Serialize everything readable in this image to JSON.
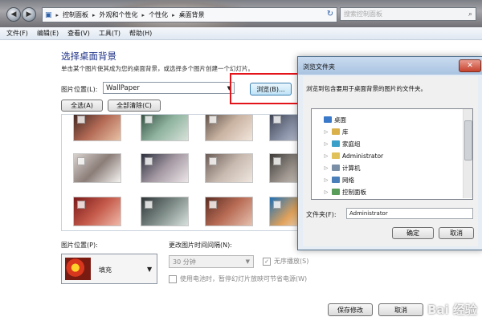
{
  "address_bar": {
    "breadcrumbs": [
      "控制面板",
      "外观和个性化",
      "个性化",
      "桌面背景"
    ],
    "search_placeholder": "搜索控制面板"
  },
  "menu": [
    "文件(F)",
    "编辑(E)",
    "查看(V)",
    "工具(T)",
    "帮助(H)"
  ],
  "main": {
    "heading": "选择桌面背景",
    "description": "单击某个图片使其成为您的桌面背景，或选择多个图片创建一个幻灯片。",
    "location_label": "图片位置(L):",
    "location_value": "WallPaper",
    "browse_label": "浏览(B)...",
    "select_all_label": "全选(A)",
    "clear_all_label": "全部清除(C)"
  },
  "thumbnails": [
    {
      "colors": [
        "#3b2420",
        "#b36a55",
        "#e8c1a5"
      ]
    },
    {
      "colors": [
        "#2f4b3c",
        "#8fb39f",
        "#d8e2d9"
      ]
    },
    {
      "colors": [
        "#5a4d46",
        "#c9b3a2",
        "#f2e6dc"
      ]
    },
    {
      "colors": [
        "#3a3e4f",
        "#8a93a8",
        "#dcdde4"
      ]
    },
    {
      "colors": [
        "#d8d2ce",
        "#8b7d78",
        "#f5f3f1"
      ]
    },
    {
      "colors": [
        "#2b2f3d",
        "#a59aa4",
        "#ede6e8"
      ]
    },
    {
      "colors": [
        "#6a5b56",
        "#c7b8ae",
        "#efe7e0"
      ]
    },
    {
      "colors": [
        "#3d3a38",
        "#9e968f",
        "#e2ddd8"
      ]
    },
    {
      "colors": [
        "#7a1a1a",
        "#c45a4a",
        "#f0b8a8"
      ]
    },
    {
      "colors": [
        "#2e3437",
        "#7c8a86",
        "#d7e0dd"
      ]
    },
    {
      "colors": [
        "#5b2c22",
        "#b86c55",
        "#e6c0ae"
      ]
    },
    {
      "colors": [
        "#1f6fb3",
        "#e0a15a",
        "#f5f5f5"
      ]
    }
  ],
  "bottom": {
    "position_label": "图片位置(P):",
    "position_value": "填充",
    "interval_label": "更改图片时间间隔(N):",
    "interval_value": "30 分钟",
    "shuffle_label": "无序播放(S)",
    "battery_label": "使用电池时，暂停幻灯片放映可节省电源(W)",
    "save_label": "保存修改",
    "cancel_label": "取消"
  },
  "dialog": {
    "title": "浏览文件夹",
    "instruction": "浏览到包含要用于桌面背景的图片的文件夹。",
    "tree": [
      {
        "label": "桌面",
        "level": 0,
        "arrow": "",
        "icon_color": "#3a78c9"
      },
      {
        "label": "库",
        "level": 1,
        "arrow": "▷",
        "icon_color": "#d9b04a"
      },
      {
        "label": "家庭组",
        "level": 1,
        "arrow": "▷",
        "icon_color": "#3aa0c9"
      },
      {
        "label": "Administrator",
        "level": 1,
        "arrow": "▷",
        "icon_color": "#e1c25a"
      },
      {
        "label": "计算机",
        "level": 1,
        "arrow": "▷",
        "icon_color": "#7a8fa6"
      },
      {
        "label": "网络",
        "level": 1,
        "arrow": "▷",
        "icon_color": "#4a7fb9"
      },
      {
        "label": "控制面板",
        "level": 1,
        "arrow": "▷",
        "icon_color": "#5a9c5a"
      }
    ],
    "folder_label": "文件夹(F):",
    "folder_value": "Administrator",
    "ok_label": "确定",
    "cancel_label": "取消"
  },
  "watermark": "Bai 经验"
}
